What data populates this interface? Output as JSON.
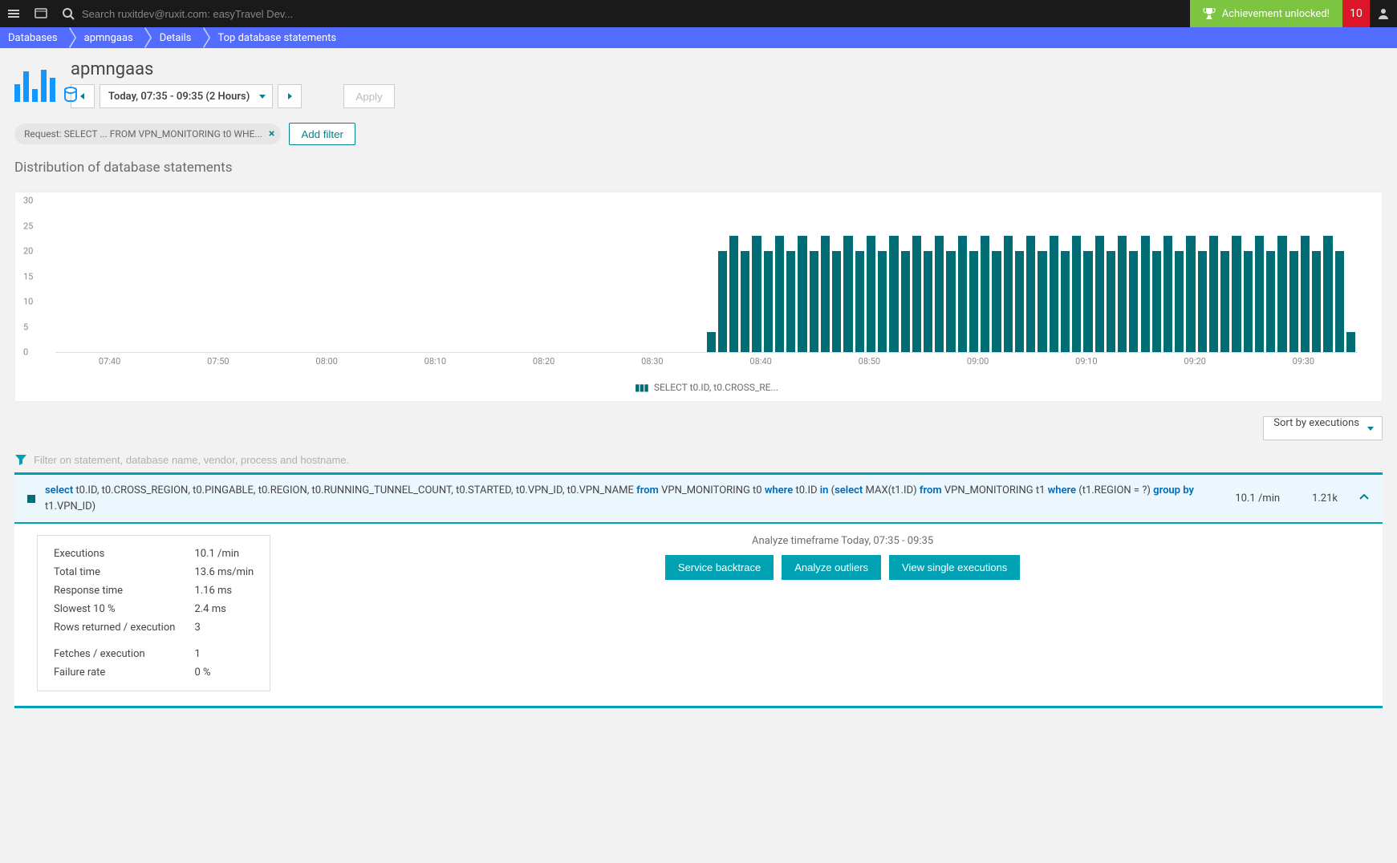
{
  "topbar": {
    "search_placeholder": "Search ruxitdev@ruxit.com: easyTravel Dev...",
    "achievement": "Achievement unlocked!",
    "alerts": "10"
  },
  "breadcrumbs": [
    "Databases",
    "apmngaas",
    "Details",
    "Top database statements"
  ],
  "header": {
    "title": "apmngaas",
    "timeframe": "Today, 07:35 - 09:35 (2 Hours)",
    "apply": "Apply"
  },
  "filters": {
    "chip_prefix": "Request: ",
    "chip_value": "SELECT ... FROM VPN_MONITORING t0 WHE...",
    "add_filter": "Add filter"
  },
  "section_title": "Distribution of database statements",
  "chart_data": {
    "type": "bar",
    "title": "Distribution of database statements",
    "ylabel": "",
    "xlabel": "",
    "ylim": [
      0,
      30
    ],
    "yticks": [
      0,
      5,
      10,
      15,
      20,
      25,
      30
    ],
    "xticks": [
      "07:40",
      "07:50",
      "08:00",
      "08:10",
      "08:20",
      "08:30",
      "08:40",
      "08:50",
      "09:00",
      "09:10",
      "09:20",
      "09:30"
    ],
    "categories_start": "08:35",
    "series": [
      {
        "name": "SELECT t0.ID, t0.CROSS_RE...",
        "values": [
          4,
          20,
          23,
          20,
          23,
          20,
          23,
          20,
          23,
          20,
          23,
          20,
          23,
          20,
          23,
          20,
          23,
          20,
          23,
          20,
          23,
          20,
          23,
          20,
          23,
          20,
          23,
          20,
          23,
          20,
          23,
          20,
          23,
          20,
          23,
          20,
          23,
          20,
          23,
          20,
          23,
          20,
          23,
          20,
          23,
          20,
          23,
          20,
          23,
          20,
          23,
          20,
          23,
          20,
          23,
          20,
          4
        ]
      }
    ],
    "legend": "SELECT t0.ID, t0.CROSS_RE..."
  },
  "sort": {
    "label": "Sort by executions"
  },
  "stmt_filter_placeholder": "Filter on statement, database name, vendor, process and hostname.",
  "statement": {
    "sql_parts": [
      {
        "t": "kw",
        "v": "select"
      },
      {
        "t": "txt",
        "v": " t0.ID, t0.CROSS_REGION, t0.PINGABLE, t0.REGION, t0.RUNNING_TUNNEL_COUNT, t0.STARTED, t0.VPN_ID, t0.VPN_NAME "
      },
      {
        "t": "kw",
        "v": "from"
      },
      {
        "t": "txt",
        "v": " VPN_MONITORING t0 "
      },
      {
        "t": "kw",
        "v": "where"
      },
      {
        "t": "txt",
        "v": " t0.ID "
      },
      {
        "t": "kw",
        "v": "in"
      },
      {
        "t": "txt",
        "v": " ("
      },
      {
        "t": "kw",
        "v": "select"
      },
      {
        "t": "txt",
        "v": " MAX(t1.ID) "
      },
      {
        "t": "kw",
        "v": "from"
      },
      {
        "t": "txt",
        "v": " VPN_MONITORING t1 "
      },
      {
        "t": "kw",
        "v": "where"
      },
      {
        "t": "txt",
        "v": " (t1.REGION = ?) "
      },
      {
        "t": "kw",
        "v": "group by"
      },
      {
        "t": "txt",
        "v": " t1.VPN_ID)"
      }
    ],
    "rate": "10.1 /min",
    "total": "1.21k"
  },
  "detail": {
    "analyze_label": "Analyze timeframe Today, 07:35 - 09:35",
    "buttons": {
      "backtrace": "Service backtrace",
      "outliers": "Analyze outliers",
      "single": "View single executions"
    },
    "stats": [
      {
        "k": "Executions",
        "v": "10.1 /min"
      },
      {
        "k": "Total time",
        "v": "13.6 ms/min"
      },
      {
        "k": "Response time",
        "v": "1.16 ms"
      },
      {
        "k": "Slowest 10 %",
        "v": "2.4 ms"
      },
      {
        "k": "Rows returned / execution",
        "v": "3"
      }
    ],
    "stats2": [
      {
        "k": "Fetches / execution",
        "v": "1"
      },
      {
        "k": "Failure rate",
        "v": "0 %"
      }
    ]
  }
}
